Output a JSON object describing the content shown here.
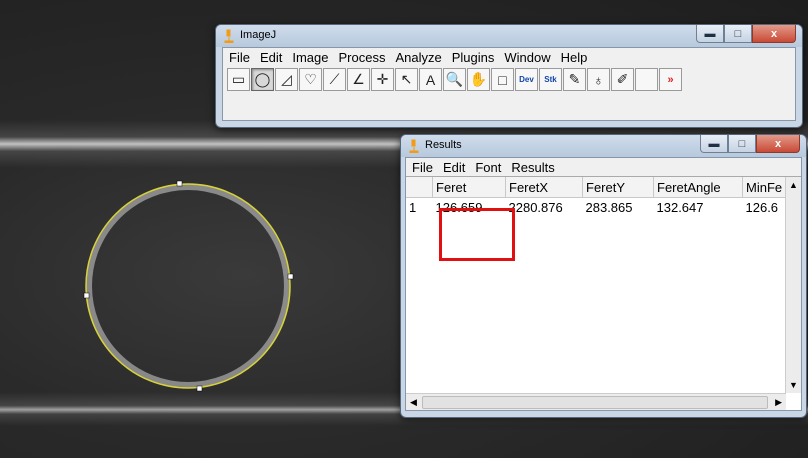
{
  "colors": {
    "roi": "#d7d23a",
    "highlight": "#e01010",
    "icon_orange": "#f39b12"
  },
  "imagej": {
    "title": "ImageJ",
    "menus": [
      "File",
      "Edit",
      "Image",
      "Process",
      "Analyze",
      "Plugins",
      "Window",
      "Help"
    ],
    "tools": [
      {
        "name": "rectangle-tool-icon",
        "glyph": "▭"
      },
      {
        "name": "oval-tool-icon",
        "glyph": "◯",
        "active": true
      },
      {
        "name": "polygon-tool-icon",
        "glyph": "◿"
      },
      {
        "name": "freehand-tool-icon",
        "glyph": "♡"
      },
      {
        "name": "line-tool-icon",
        "glyph": "⟋"
      },
      {
        "name": "angle-tool-icon",
        "glyph": "∠"
      },
      {
        "name": "point-tool-icon",
        "glyph": "✛"
      },
      {
        "name": "wand-tool-icon",
        "glyph": "↖"
      },
      {
        "name": "text-tool-icon",
        "glyph": "A"
      },
      {
        "name": "magnifier-tool-icon",
        "glyph": "🔍"
      },
      {
        "name": "hand-tool-icon",
        "glyph": "✋"
      },
      {
        "name": "dropper-tool-icon",
        "glyph": "□"
      },
      {
        "name": "dev-menu-icon",
        "glyph": "Dev",
        "small": true
      },
      {
        "name": "stk-menu-icon",
        "glyph": "Stk",
        "small": true
      },
      {
        "name": "brush-tool-icon",
        "glyph": "✎"
      },
      {
        "name": "flood-fill-tool-icon",
        "glyph": "♁"
      },
      {
        "name": "pencil-tool-icon",
        "glyph": "✐"
      },
      {
        "name": "blank-tool-icon",
        "glyph": ""
      },
      {
        "name": "more-tools-icon",
        "glyph": "»",
        "red": true
      }
    ],
    "controls": {
      "minimize": "▬",
      "maximize": "□",
      "close": "x"
    }
  },
  "results": {
    "title": "Results",
    "menus": [
      "File",
      "Edit",
      "Font",
      "Results"
    ],
    "columns": [
      "",
      "Feret",
      "FeretX",
      "FeretY",
      "FeretAngle",
      "MinFe"
    ],
    "rows": [
      [
        "1",
        "126.659",
        "2280.876",
        "283.865",
        "132.647",
        "126.6"
      ]
    ],
    "controls": {
      "minimize": "▬",
      "maximize": "□",
      "close": "x"
    }
  }
}
